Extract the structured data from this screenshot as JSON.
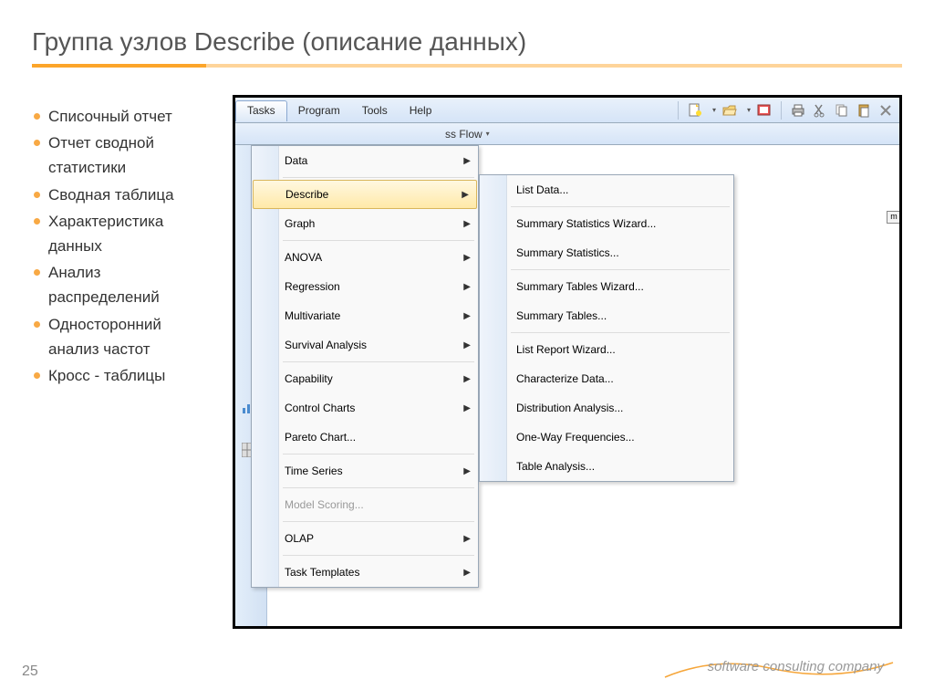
{
  "slide": {
    "title": "Группа узлов Describe (описание данных)",
    "page_number": "25",
    "footer": "software consulting company"
  },
  "bullets": [
    "Списочный отчет",
    "Отчет сводной статистики",
    "Сводная таблица",
    "Характеристика данных",
    "Анализ распределений",
    "Односторонний анализ частот",
    "Кросс - таблицы"
  ],
  "menubar": [
    "Tasks",
    "Program",
    "Tools",
    "Help"
  ],
  "toolbar2_label": "ss Flow",
  "tasks_menu": [
    {
      "label": "Data",
      "arrow": true
    },
    {
      "sep": true
    },
    {
      "label": "Describe",
      "arrow": true,
      "selected": true
    },
    {
      "label": "Graph",
      "arrow": true
    },
    {
      "sep": true
    },
    {
      "label": "ANOVA",
      "arrow": true
    },
    {
      "label": "Regression",
      "arrow": true
    },
    {
      "label": "Multivariate",
      "arrow": true
    },
    {
      "label": "Survival Analysis",
      "arrow": true
    },
    {
      "sep": true
    },
    {
      "label": "Capability",
      "arrow": true
    },
    {
      "label": "Control Charts",
      "arrow": true
    },
    {
      "label": "Pareto Chart..."
    },
    {
      "sep": true
    },
    {
      "label": "Time Series",
      "arrow": true
    },
    {
      "sep": true
    },
    {
      "label": "Model Scoring...",
      "disabled": true
    },
    {
      "sep": true
    },
    {
      "label": "OLAP",
      "arrow": true
    },
    {
      "sep": true
    },
    {
      "label": "Task Templates",
      "arrow": true
    }
  ],
  "describe_submenu": [
    {
      "icon": "table-icon",
      "label": "List Data..."
    },
    {
      "sep": true
    },
    {
      "icon": "wizard-icon",
      "label": "Summary Statistics Wizard..."
    },
    {
      "icon": "sigma-icon",
      "label": "Summary Statistics..."
    },
    {
      "sep": true
    },
    {
      "icon": "tables-wizard-icon",
      "label": "Summary Tables Wizard..."
    },
    {
      "icon": "tables-icon",
      "label": "Summary Tables..."
    },
    {
      "sep": true
    },
    {
      "icon": "report-wizard-icon",
      "label": "List Report Wizard..."
    },
    {
      "icon": "characterize-icon",
      "label": "Characterize Data..."
    },
    {
      "icon": "histogram-icon",
      "label": "Distribution Analysis..."
    },
    {
      "icon": "freq-icon",
      "label": "One-Way Frequencies..."
    },
    {
      "icon": "crosstab-icon",
      "label": "Table Analysis..."
    }
  ],
  "right_edge_char": "m"
}
